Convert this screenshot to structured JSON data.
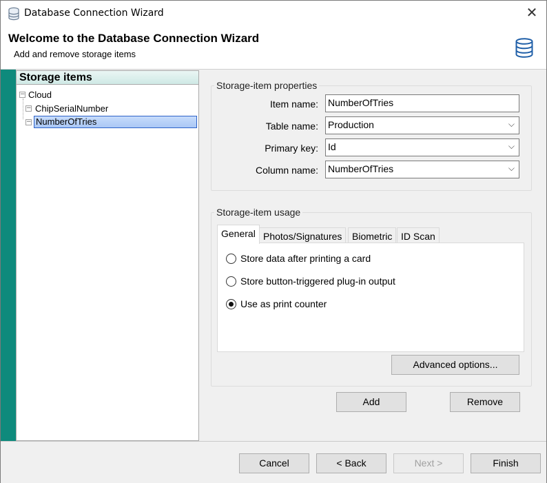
{
  "window": {
    "title": "Database Connection Wizard"
  },
  "header": {
    "title": "Welcome to the Database Connection Wizard",
    "subtitle": "Add and remove storage items"
  },
  "tree": {
    "heading": "Storage items",
    "root": {
      "label": "Cloud",
      "expander": "−",
      "children": [
        {
          "label": "ChipSerialNumber",
          "expander": "−"
        },
        {
          "label": "NumberOfTries",
          "expander": "−",
          "selected": true
        }
      ]
    }
  },
  "properties": {
    "group_label": "Storage-item properties",
    "item_name_label": "Item name:",
    "item_name_value": "NumberOfTries",
    "table_name_label": "Table name:",
    "table_name_value": "Production",
    "primary_key_label": "Primary key:",
    "primary_key_value": "Id",
    "column_name_label": "Column name:",
    "column_name_value": "NumberOfTries"
  },
  "usage": {
    "group_label": "Storage-item usage",
    "tabs": [
      {
        "label": "General",
        "active": true
      },
      {
        "label": "Photos/Signatures",
        "active": false
      },
      {
        "label": "Biometric",
        "active": false
      },
      {
        "label": "ID Scan",
        "active": false
      }
    ],
    "options": [
      {
        "label": "Store data after printing a card",
        "checked": false
      },
      {
        "label": "Store button-triggered plug-in output",
        "checked": false
      },
      {
        "label": "Use as print counter",
        "checked": true
      }
    ],
    "advanced_label": "Advanced options..."
  },
  "actions": {
    "add_label": "Add",
    "remove_label": "Remove"
  },
  "footer": {
    "cancel_label": "Cancel",
    "back_label": "< Back",
    "next_label": "Next >",
    "finish_label": "Finish"
  },
  "colors": {
    "accent_stripe": "#0e8a7c",
    "selection": "#a9c7f5"
  }
}
